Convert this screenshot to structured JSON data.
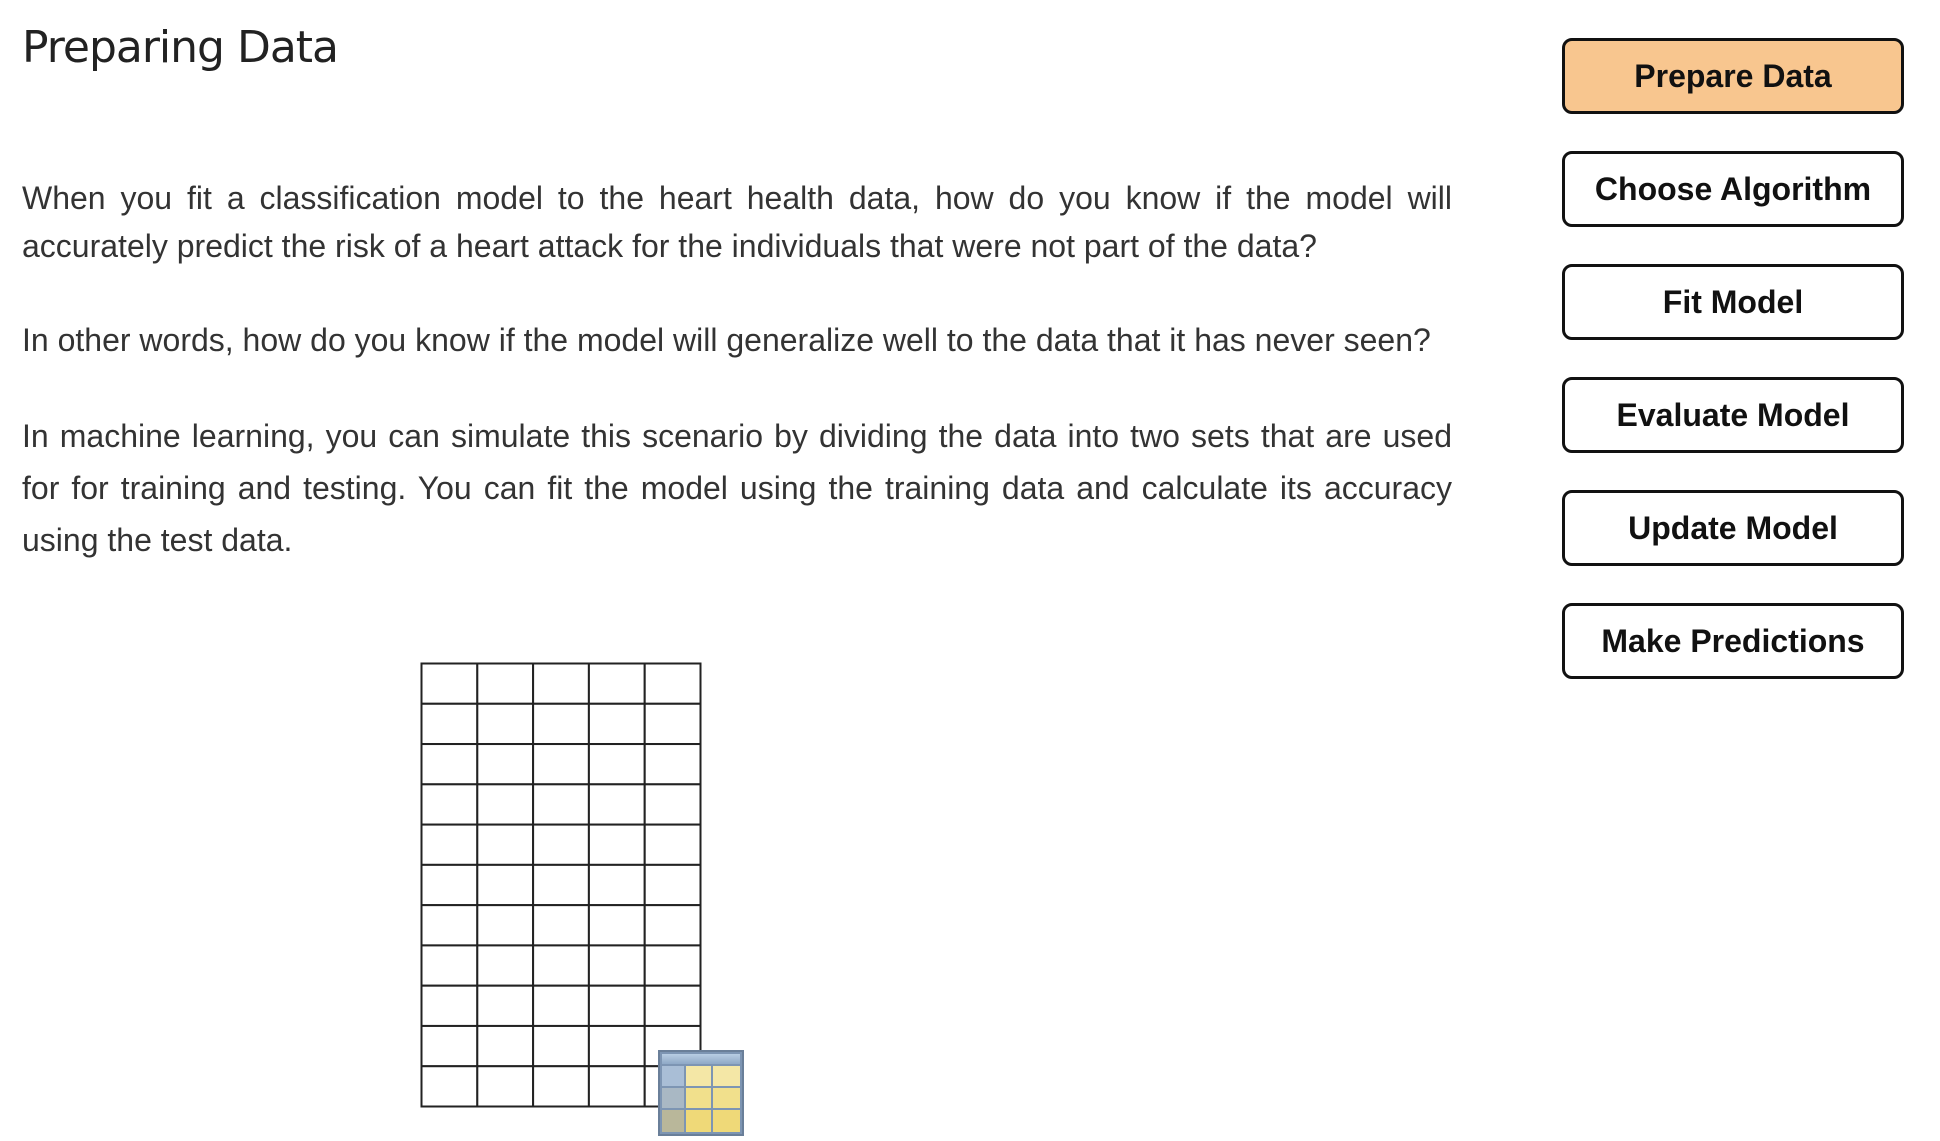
{
  "page": {
    "title": "Preparing Data"
  },
  "content": {
    "paragraphs": [
      "When you fit a classification model to the heart health data, how do you know if the model will accurately predict the risk of a heart attack for the individuals that were not part of the data?",
      "In other words, how do you know if the model will generalize well to the data that it has never seen?",
      "In machine learning, you can simulate this scenario by dividing the data into two sets that are used for for training and testing. You can fit the model using the training data and calculate its accuracy using the test data."
    ]
  },
  "figure": {
    "grid_rows": 11,
    "grid_cols": 5,
    "icon": "table-icon"
  },
  "nav": {
    "items": [
      {
        "label": "Prepare Data",
        "active": true
      },
      {
        "label": "Choose Algorithm",
        "active": false
      },
      {
        "label": "Fit Model",
        "active": false
      },
      {
        "label": "Evaluate Model",
        "active": false
      },
      {
        "label": "Update Model",
        "active": false
      },
      {
        "label": "Make Predictions",
        "active": false
      }
    ]
  },
  "colors": {
    "active_button": "#f8c68f",
    "button_border": "#111111",
    "text": "#333333"
  }
}
